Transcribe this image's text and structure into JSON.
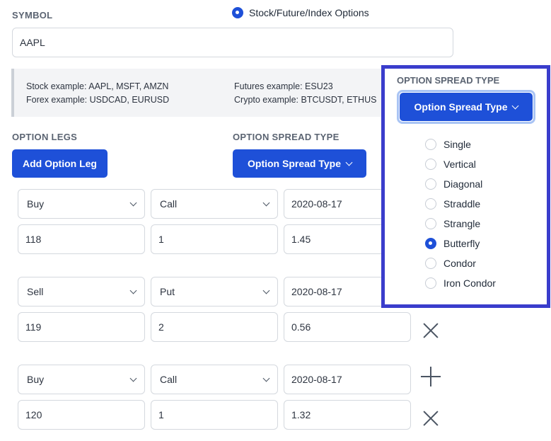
{
  "symbol": {
    "label": "SYMBOL",
    "value": "AAPL"
  },
  "asset_type": {
    "label": "Stock/Future/Index Options",
    "selected": true
  },
  "examples": {
    "stock": "Stock example: AAPL, MSFT, AMZN",
    "forex": "Forex example: USDCAD, EURUSD",
    "futures": "Futures example: ESU23",
    "crypto": "Crypto example: BTCUSDT, ETHUS"
  },
  "option_legs": {
    "label": "OPTION LEGS",
    "add_button": "Add Option Leg"
  },
  "spread_type": {
    "label": "OPTION SPREAD TYPE",
    "button": "Option Spread Type"
  },
  "legs": [
    {
      "side": "Buy",
      "type": "Call",
      "expiry": "2020-08-17",
      "strike": "118",
      "quantity": "1",
      "price": "1.45"
    },
    {
      "side": "Sell",
      "type": "Put",
      "expiry": "2020-08-17",
      "strike": "119",
      "quantity": "2",
      "price": "0.56"
    },
    {
      "side": "Buy",
      "type": "Call",
      "expiry": "2020-08-17",
      "strike": "120",
      "quantity": "1",
      "price": "1.32"
    }
  ],
  "dropdown": {
    "label": "OPTION SPREAD TYPE",
    "button": "Option Spread Type",
    "options": [
      "Single",
      "Vertical",
      "Diagonal",
      "Straddle",
      "Strangle",
      "Butterfly",
      "Condor",
      "Iron Condor"
    ],
    "selected": "Butterfly"
  },
  "colors": {
    "primary": "#1e50d8",
    "highlight_border": "#3a3dcc"
  }
}
